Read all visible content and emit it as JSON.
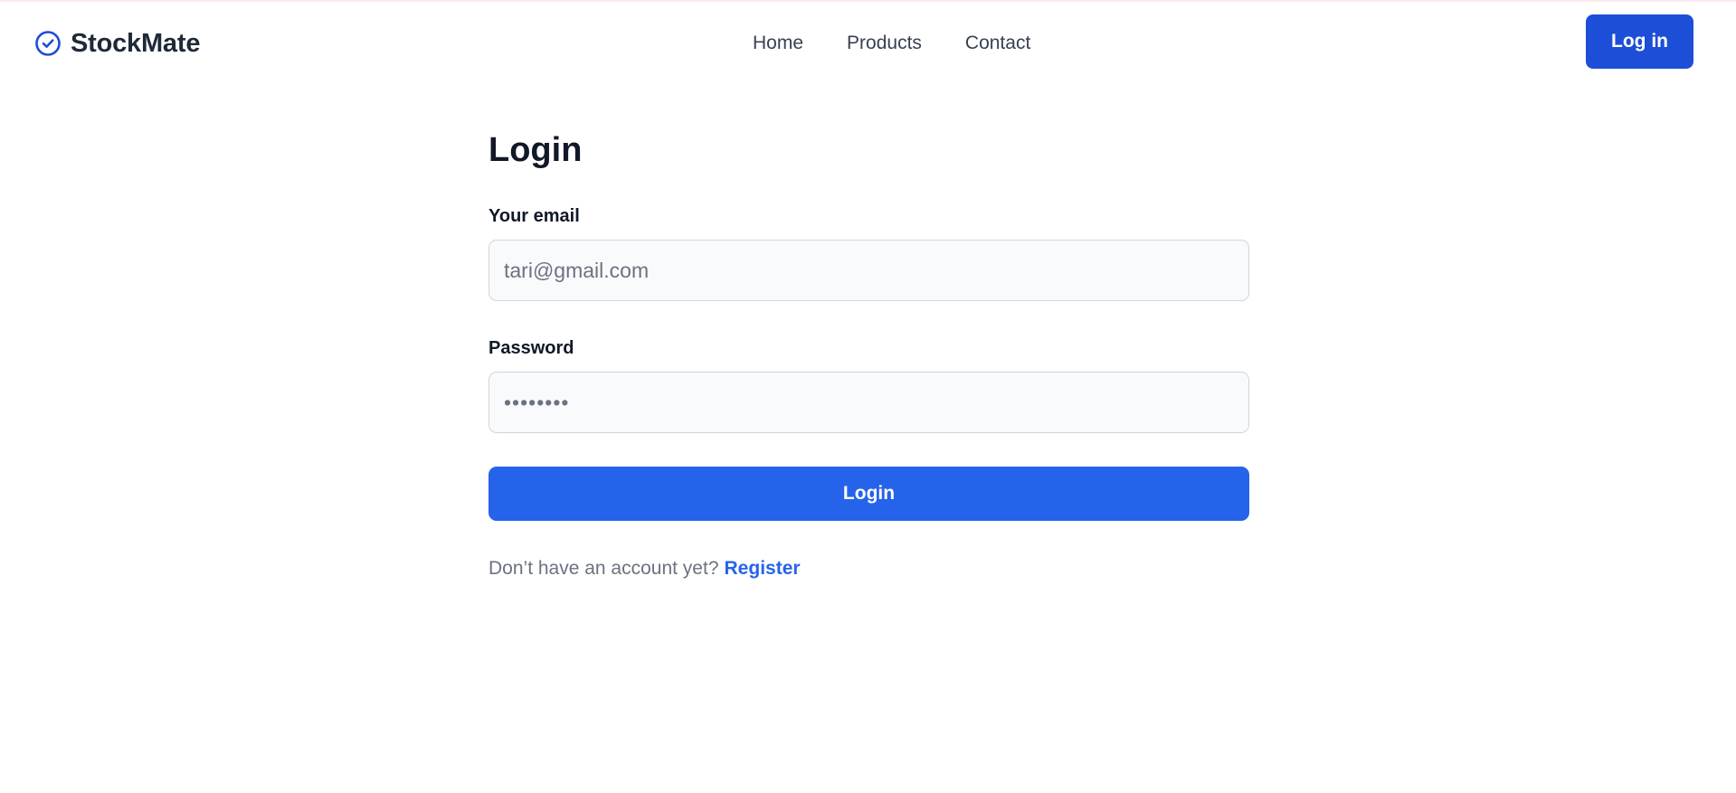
{
  "brand": {
    "name": "StockMate",
    "icon": "check-circle-icon",
    "accent_color": "#1d4ed8"
  },
  "nav": {
    "links": [
      {
        "label": "Home"
      },
      {
        "label": "Products"
      },
      {
        "label": "Contact"
      }
    ],
    "login_button": "Log in"
  },
  "form": {
    "title": "Login",
    "email_label": "Your email",
    "email_value": "tari@gmail.com",
    "password_label": "Password",
    "password_value": "••••••••",
    "submit_label": "Login",
    "register_prompt": "Don’t have an account yet?",
    "register_link": "Register"
  },
  "colors": {
    "primary_button": "#2563eb",
    "nav_button": "#1d4ed8",
    "input_background": "#f9fafb"
  }
}
